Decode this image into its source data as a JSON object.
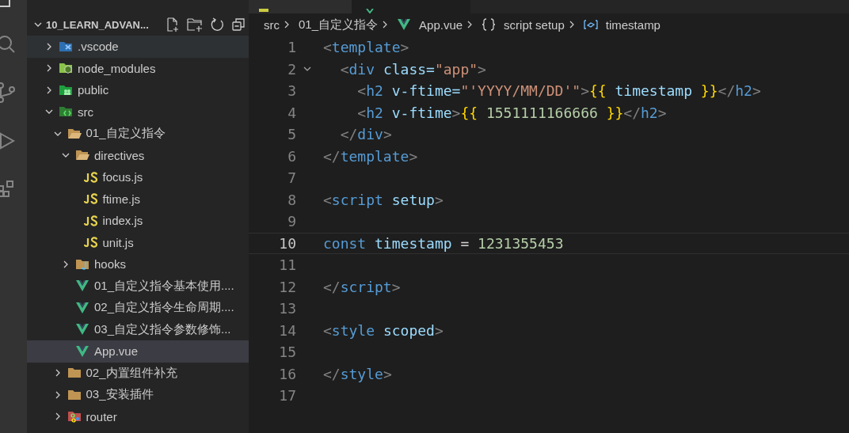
{
  "explorer": {
    "project": "10_LEARN_ADVAN...",
    "tree": [
      {
        "label": ".vscode",
        "kind": "vscode-folder",
        "expanded": false,
        "selected": false,
        "hovered": true
      },
      {
        "label": "node_modules",
        "kind": "node-folder",
        "expanded": false,
        "selected": false,
        "hovered": false
      },
      {
        "label": "public",
        "kind": "public-folder",
        "expanded": false,
        "selected": false,
        "hovered": false
      },
      {
        "label": "src",
        "kind": "src-folder",
        "expanded": true,
        "selected": false,
        "hovered": false,
        "children": [
          {
            "label": "01_自定义指令",
            "kind": "folder",
            "expanded": true,
            "selected": false,
            "hovered": false,
            "children": [
              {
                "label": "directives",
                "kind": "folder",
                "expanded": true,
                "selected": false,
                "hovered": false,
                "children": [
                  {
                    "label": "focus.js",
                    "kind": "js-file",
                    "selected": false,
                    "hovered": false
                  },
                  {
                    "label": "ftime.js",
                    "kind": "js-file",
                    "selected": false,
                    "hovered": false
                  },
                  {
                    "label": "index.js",
                    "kind": "js-file",
                    "selected": false,
                    "hovered": false
                  },
                  {
                    "label": "unit.js",
                    "kind": "js-file",
                    "selected": false,
                    "hovered": false
                  }
                ]
              },
              {
                "label": "hooks",
                "kind": "hooks-folder",
                "expanded": false,
                "selected": false,
                "hovered": false
              },
              {
                "label": "01_自定义指令基本使用....",
                "kind": "vue-file",
                "selected": false,
                "hovered": false
              },
              {
                "label": "02_自定义指令生命周期....",
                "kind": "vue-file",
                "selected": false,
                "hovered": false
              },
              {
                "label": "03_自定义指令参数修饰...",
                "kind": "vue-file",
                "selected": false,
                "hovered": false
              },
              {
                "label": "App.vue",
                "kind": "vue-file",
                "selected": true,
                "hovered": false
              }
            ]
          },
          {
            "label": "02_内置组件补充",
            "kind": "folder",
            "expanded": false,
            "selected": false,
            "hovered": false
          },
          {
            "label": "03_安装插件",
            "kind": "folder",
            "expanded": false,
            "selected": false,
            "hovered": false
          },
          {
            "label": "router",
            "kind": "router-folder",
            "expanded": false,
            "selected": false,
            "hovered": false
          }
        ]
      }
    ]
  },
  "breadcrumb": [
    {
      "label": "src",
      "kind": "text"
    },
    {
      "label": "01_自定义指令",
      "kind": "text"
    },
    {
      "label": "App.vue",
      "kind": "vue"
    },
    {
      "label": "script setup",
      "kind": "braces"
    },
    {
      "label": "timestamp",
      "kind": "variable"
    }
  ],
  "editor": {
    "lines": [
      {
        "number": "1",
        "current": false,
        "foldable": false,
        "tokens": [
          {
            "kind": "punct",
            "text": "<"
          },
          {
            "kind": "tag",
            "text": "template"
          },
          {
            "kind": "punct",
            "text": ">"
          }
        ]
      },
      {
        "number": "2",
        "current": false,
        "foldable": true,
        "tokens": [
          {
            "kind": "punct",
            "text": "  <"
          },
          {
            "kind": "tag",
            "text": "div "
          },
          {
            "kind": "attr",
            "text": "class="
          },
          {
            "kind": "string",
            "text": "\"app\""
          },
          {
            "kind": "punct",
            "text": ">"
          }
        ]
      },
      {
        "number": "3",
        "current": false,
        "foldable": false,
        "tokens": [
          {
            "kind": "punct",
            "text": "    <"
          },
          {
            "kind": "tag",
            "text": "h2 "
          },
          {
            "kind": "attr",
            "text": "v-ftime="
          },
          {
            "kind": "string",
            "text": "\"'YYYY/MM/DD'\""
          },
          {
            "kind": "punct",
            "text": ">"
          },
          {
            "kind": "mustache",
            "text": "{{ "
          },
          {
            "kind": "variable",
            "text": "timestamp "
          },
          {
            "kind": "mustache",
            "text": "}}"
          },
          {
            "kind": "punct",
            "text": "</"
          },
          {
            "kind": "tag",
            "text": "h2"
          },
          {
            "kind": "punct",
            "text": ">"
          }
        ]
      },
      {
        "number": "4",
        "current": false,
        "foldable": false,
        "tokens": [
          {
            "kind": "punct",
            "text": "    <"
          },
          {
            "kind": "tag",
            "text": "h2 "
          },
          {
            "kind": "attr",
            "text": "v-ftime"
          },
          {
            "kind": "punct",
            "text": ">"
          },
          {
            "kind": "mustache",
            "text": "{{ "
          },
          {
            "kind": "number",
            "text": "1551111166666 "
          },
          {
            "kind": "mustache",
            "text": "}}"
          },
          {
            "kind": "punct",
            "text": "</"
          },
          {
            "kind": "tag",
            "text": "h2"
          },
          {
            "kind": "punct",
            "text": ">"
          }
        ]
      },
      {
        "number": "5",
        "current": false,
        "foldable": false,
        "tokens": [
          {
            "kind": "punct",
            "text": "  </"
          },
          {
            "kind": "tag",
            "text": "div"
          },
          {
            "kind": "punct",
            "text": ">"
          }
        ]
      },
      {
        "number": "6",
        "current": false,
        "foldable": false,
        "tokens": [
          {
            "kind": "punct",
            "text": "</"
          },
          {
            "kind": "tag",
            "text": "template"
          },
          {
            "kind": "punct",
            "text": ">"
          }
        ]
      },
      {
        "number": "7",
        "current": false,
        "foldable": false
      },
      {
        "number": "8",
        "current": false,
        "foldable": false,
        "tokens": [
          {
            "kind": "punct",
            "text": "<"
          },
          {
            "kind": "tag",
            "text": "script "
          },
          {
            "kind": "attr",
            "text": "setup"
          },
          {
            "kind": "punct",
            "text": ">"
          }
        ]
      },
      {
        "number": "9",
        "current": false,
        "foldable": false
      },
      {
        "number": "10",
        "current": true,
        "foldable": false,
        "tokens": [
          {
            "kind": "keyword",
            "text": "const "
          },
          {
            "kind": "variable",
            "text": "timestamp "
          },
          {
            "kind": "plain",
            "text": "= "
          },
          {
            "kind": "number",
            "text": "1231355453"
          }
        ]
      },
      {
        "number": "11",
        "current": false,
        "foldable": false
      },
      {
        "number": "12",
        "current": false,
        "foldable": false,
        "tokens": [
          {
            "kind": "punct",
            "text": "</"
          },
          {
            "kind": "tag",
            "text": "script"
          },
          {
            "kind": "punct",
            "text": ">"
          }
        ]
      },
      {
        "number": "13",
        "current": false,
        "foldable": false
      },
      {
        "number": "14",
        "current": false,
        "foldable": false,
        "tokens": [
          {
            "kind": "punct",
            "text": "<"
          },
          {
            "kind": "tag",
            "text": "style "
          },
          {
            "kind": "attr",
            "text": "scoped"
          },
          {
            "kind": "punct",
            "text": ">"
          }
        ]
      },
      {
        "number": "15",
        "current": false,
        "foldable": false
      },
      {
        "number": "16",
        "current": false,
        "foldable": false,
        "tokens": [
          {
            "kind": "punct",
            "text": "</"
          },
          {
            "kind": "tag",
            "text": "style"
          },
          {
            "kind": "punct",
            "text": ">"
          }
        ]
      },
      {
        "number": "17",
        "current": false,
        "foldable": false
      }
    ]
  }
}
